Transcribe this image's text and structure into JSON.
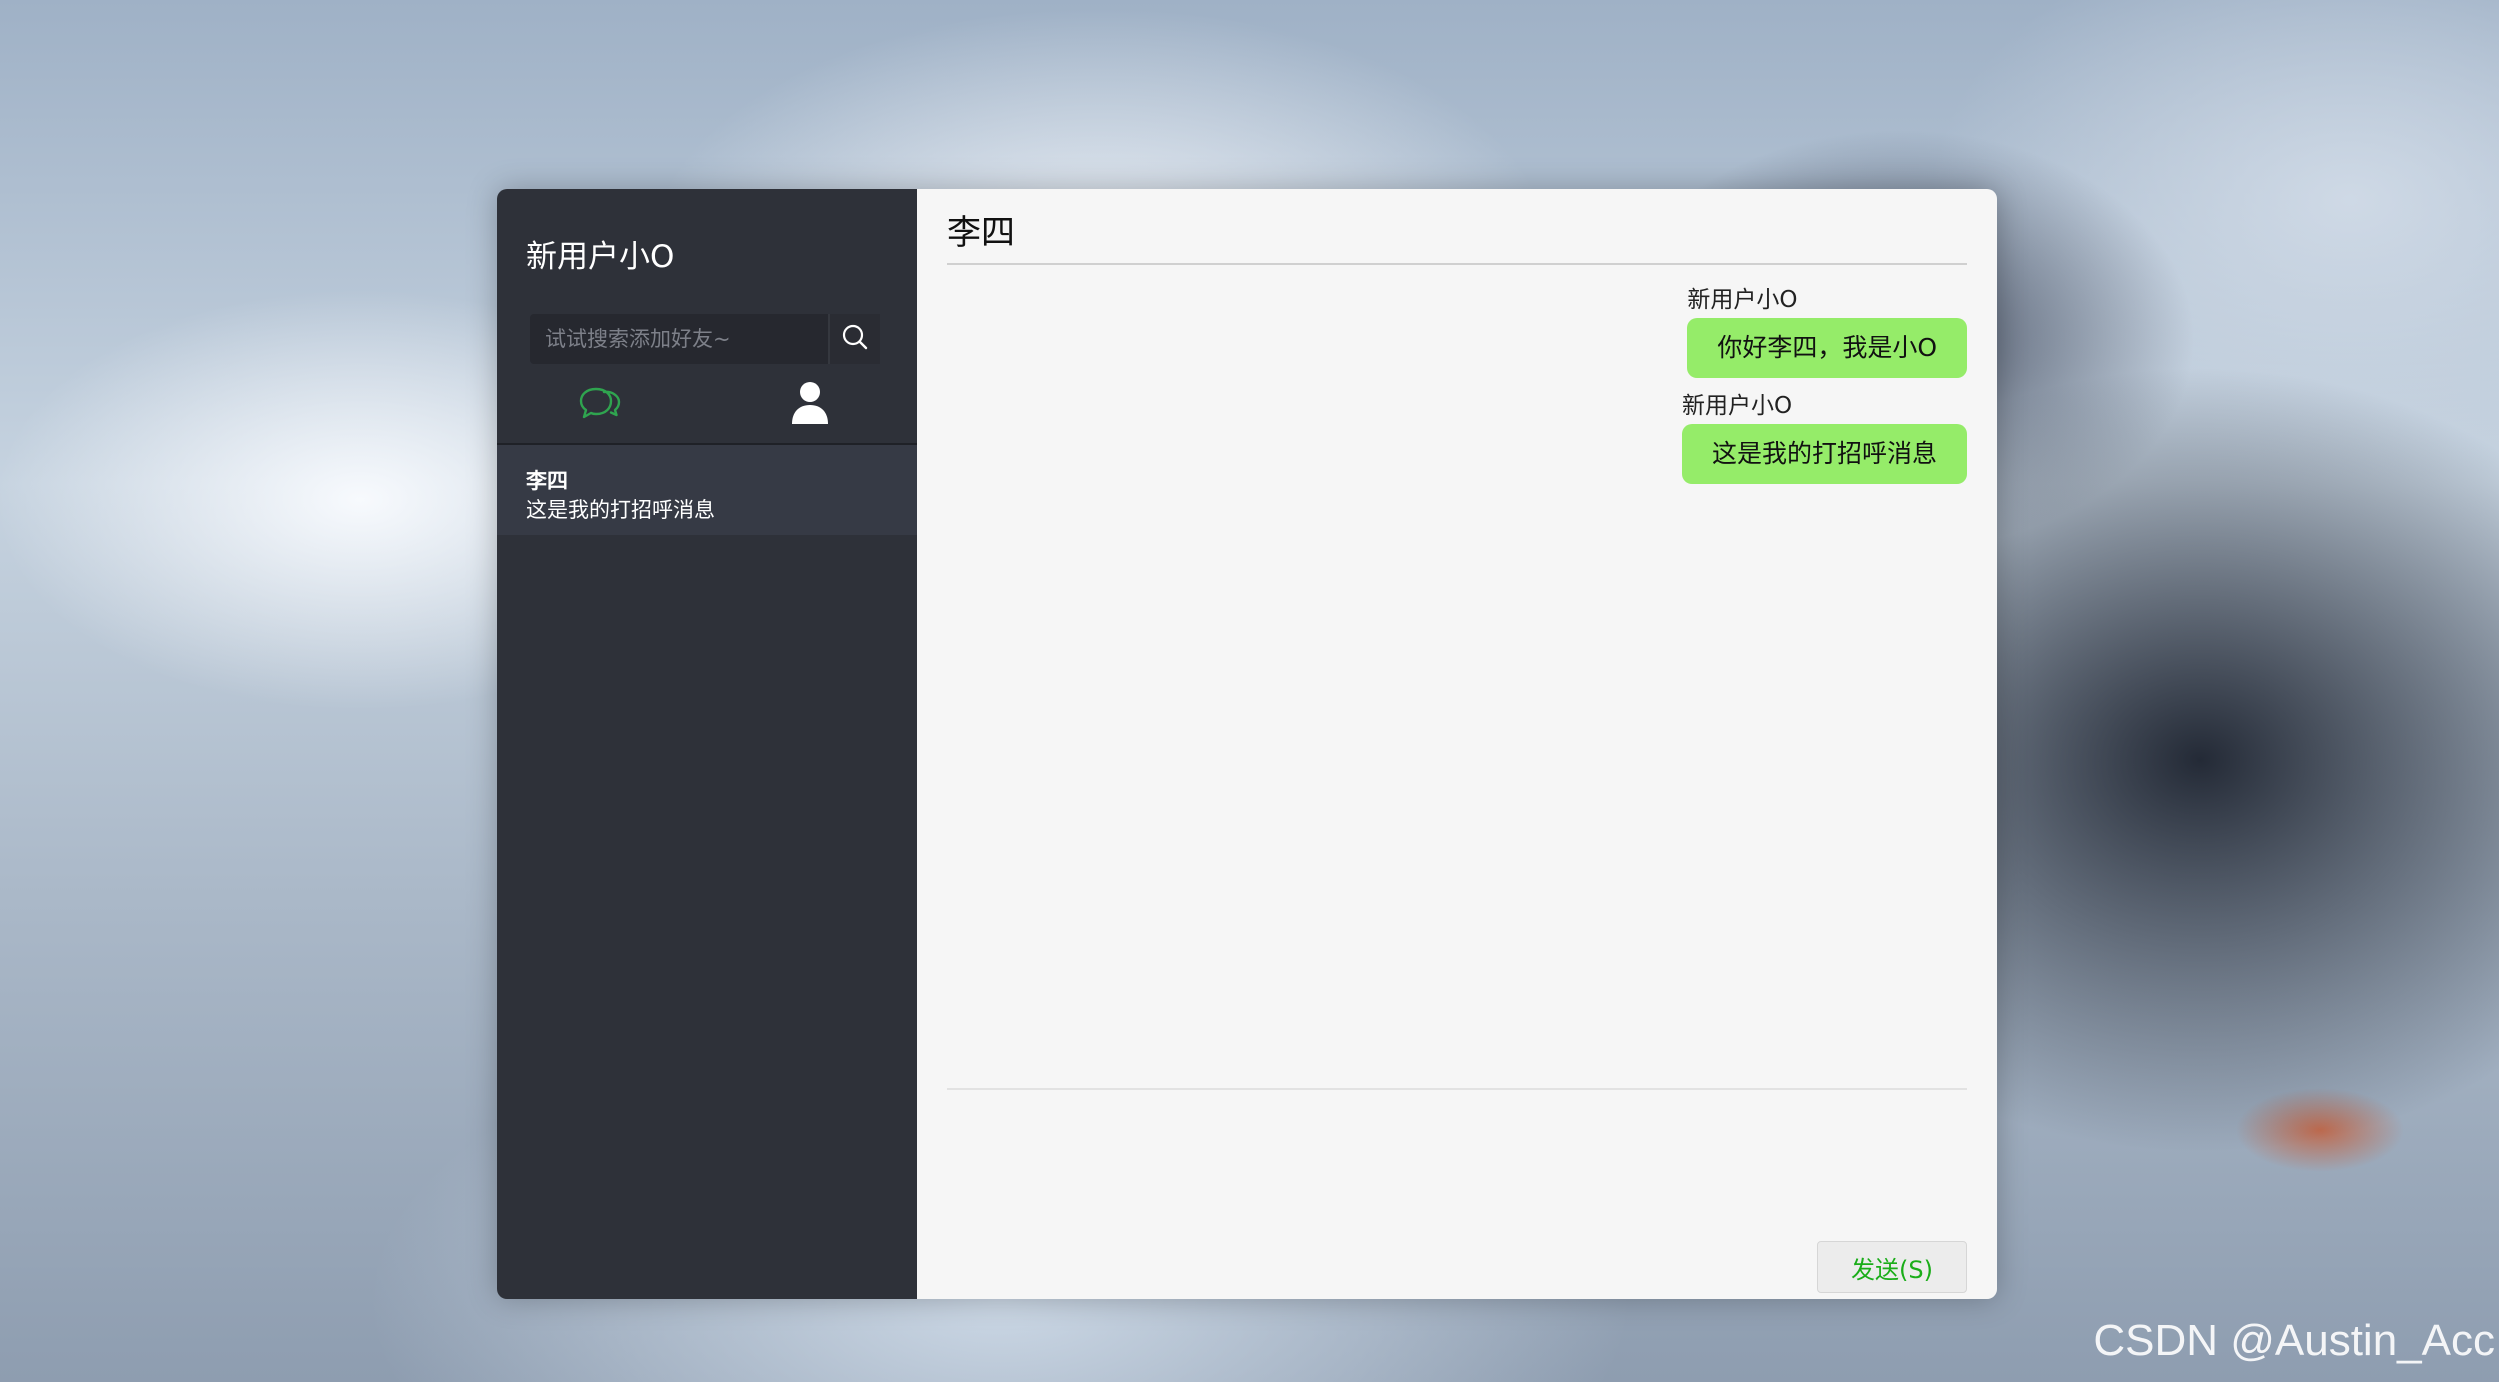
{
  "sidebar": {
    "user_name": "新用户小O",
    "search": {
      "placeholder": "试试搜索添加好友~",
      "icon": "search-icon"
    },
    "tabs": [
      {
        "name": "chat",
        "icon": "chat-bubbles-icon",
        "active": true,
        "color": "#2fa44f"
      },
      {
        "name": "contacts",
        "icon": "user-icon",
        "active": false,
        "color": "#ffffff"
      }
    ],
    "conversations": [
      {
        "name": "李四",
        "preview": "这是我的打招呼消息"
      }
    ]
  },
  "chat": {
    "title": "李四",
    "messages": [
      {
        "sender": "新用户小O",
        "text": "你好李四，我是小O"
      },
      {
        "sender": "新用户小O",
        "text": "这是我的打招呼消息"
      }
    ],
    "send_label": "发送(S)"
  },
  "watermark": "CSDN @Austin_Acc",
  "colors": {
    "bubble": "#95ec69",
    "sidebar_bg": "#2e3139",
    "accent": "#1aad19"
  }
}
